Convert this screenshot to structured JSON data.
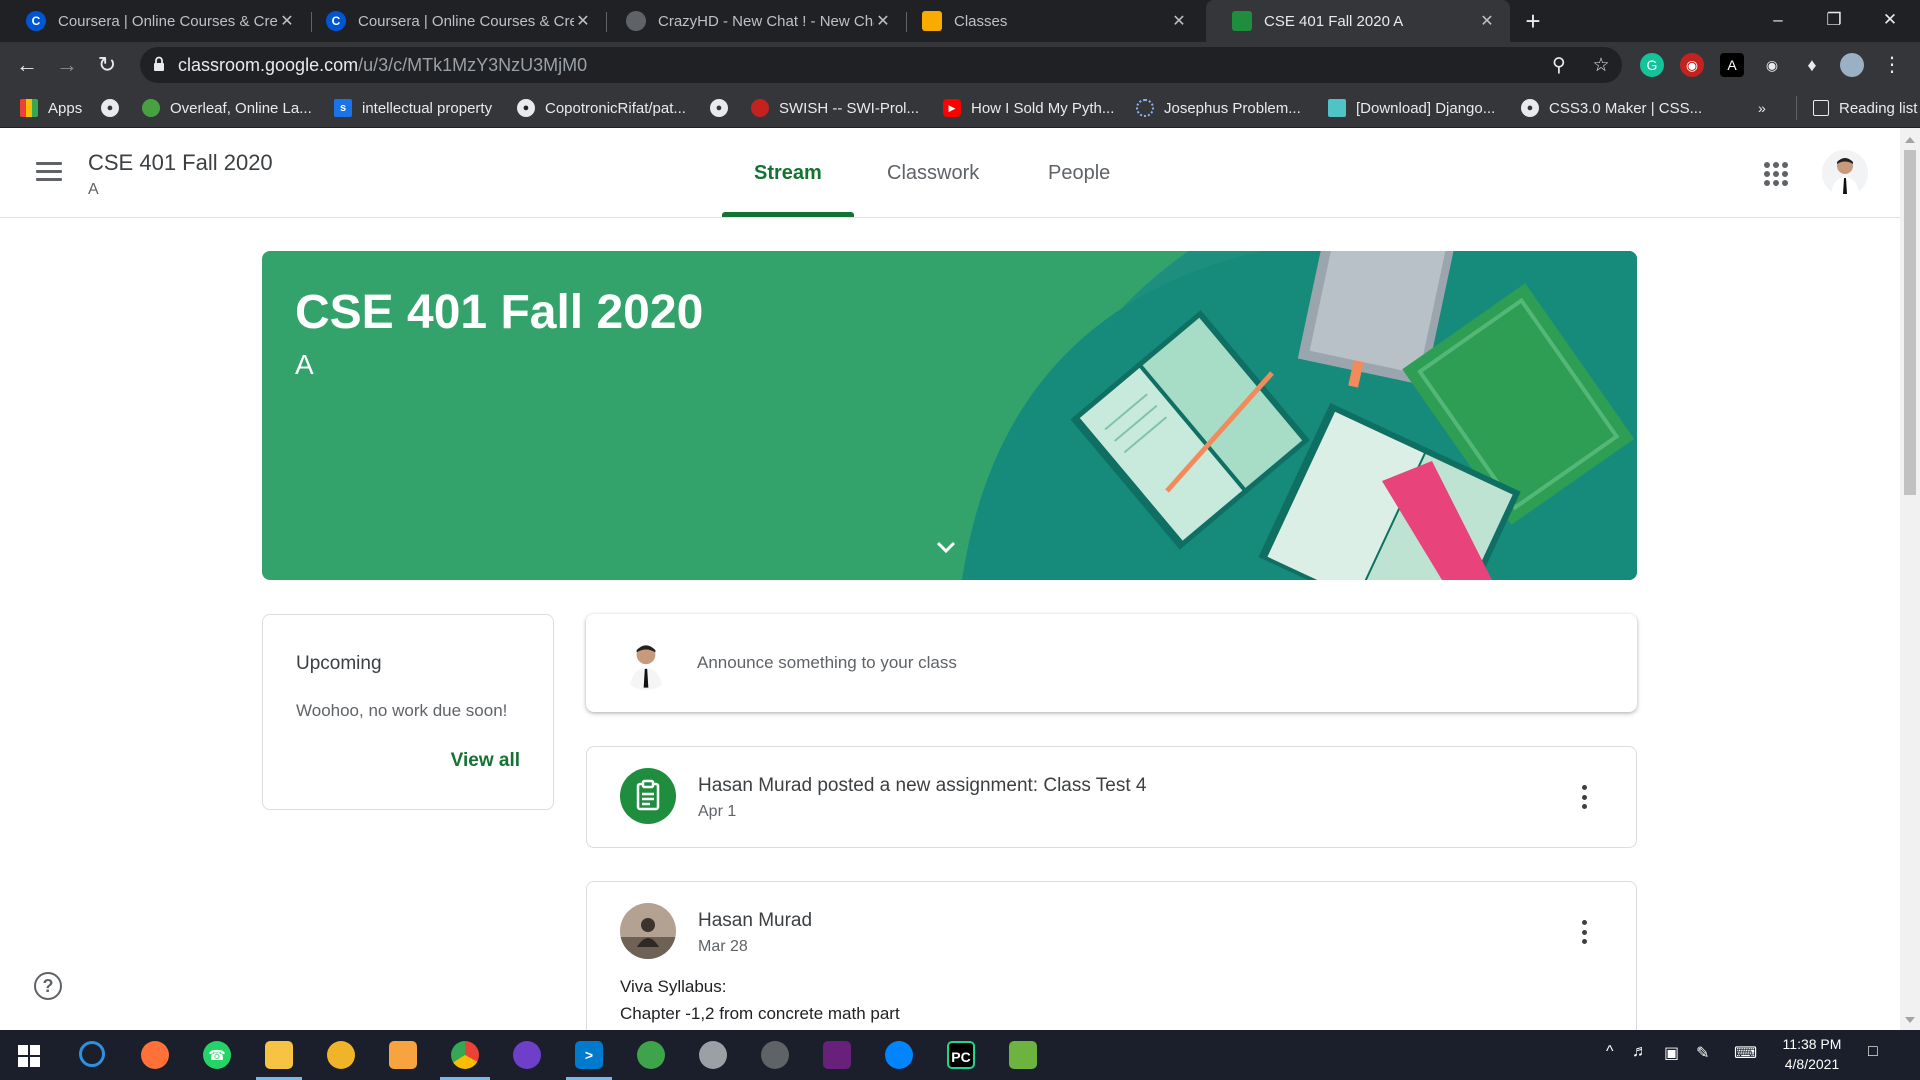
{
  "browser": {
    "tabs": [
      {
        "title": "Coursera | Online Courses & Credentials",
        "icon": "coursera-icon",
        "color": "#0056d2",
        "letter": "C"
      },
      {
        "title": "Coursera | Online Courses & Credentials",
        "icon": "coursera-icon",
        "color": "#0056d2",
        "letter": "C"
      },
      {
        "title": "CrazyHD - New Chat ! - New Chat",
        "icon": "globe-icon",
        "color": "#5f6368",
        "letter": ""
      },
      {
        "title": "Classes",
        "icon": "classroom-icon",
        "color": "#f9ab00",
        "letter": ""
      },
      {
        "title": "CSE 401 Fall 2020 A",
        "icon": "classroom-icon",
        "color": "#1e8e3e",
        "letter": ""
      }
    ],
    "url_host": "classroom.google.com",
    "url_path": "/u/3/c/MTk1MzY3NzU3MjM0",
    "bookmarks": [
      {
        "label": "Apps",
        "icon": "apps-grid-icon"
      },
      {
        "label": "",
        "icon": "globe-icon"
      },
      {
        "label": "Overleaf, Online La...",
        "icon": "overleaf-icon"
      },
      {
        "label": "intellectual property",
        "icon": "scribd-icon"
      },
      {
        "label": "CopotronicRifat/pat...",
        "icon": "github-icon"
      },
      {
        "label": "",
        "icon": "globe-icon"
      },
      {
        "label": "SWISH -- SWI-Prol...",
        "icon": "swish-icon"
      },
      {
        "label": "How I Sold My Pyth...",
        "icon": "youtube-icon"
      },
      {
        "label": "Josephus Problem...",
        "icon": "loading-icon"
      },
      {
        "label": "[Download] Django...",
        "icon": "site-icon"
      },
      {
        "label": "CSS3.0 Maker | CSS...",
        "icon": "globe-icon"
      },
      {
        "label": "Reading list",
        "icon": "reading-list-icon"
      }
    ]
  },
  "classroom": {
    "class_title": "CSE 401 Fall 2020",
    "class_section": "A",
    "nav_tabs": [
      "Stream",
      "Classwork",
      "People"
    ],
    "banner": {
      "title": "CSE 401 Fall 2020",
      "section": "A"
    },
    "upcoming": {
      "title": "Upcoming",
      "empty_text": "Woohoo, no work due soon!",
      "view_all": "View all"
    },
    "announce_placeholder": "Announce something to your class",
    "posts": [
      {
        "title": "Hasan Murad posted a new assignment: Class Test 4",
        "date": "Apr 1"
      },
      {
        "author": "Hasan Murad",
        "date": "Mar 28",
        "body": [
          "Viva Syllabus:",
          "Chapter -1,2 from concrete math part"
        ]
      }
    ],
    "help": "?"
  },
  "taskbar": {
    "time": "11:38 PM",
    "date": "4/8/2021"
  }
}
